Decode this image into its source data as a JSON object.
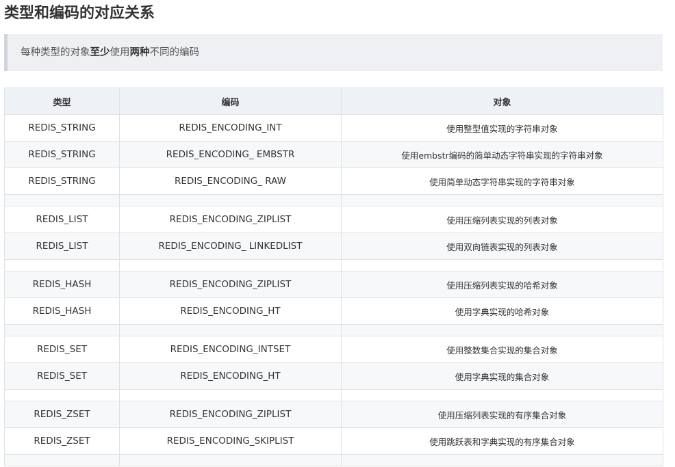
{
  "title": "类型和编码的对应关系",
  "note": {
    "part1": "每种类型的对象",
    "bold1": "至少",
    "part2": "使用",
    "bold2": "两种",
    "part3": "不同的编码"
  },
  "table": {
    "headers": [
      "类型",
      "编码",
      "对象"
    ],
    "rows": [
      {
        "type": "REDIS_STRING",
        "encoding": "REDIS_ENCODING_INT",
        "object": "使用整型值实现的字符串对象"
      },
      {
        "type": "REDIS_STRING",
        "encoding": "REDIS_ENCODING_ EMBSTR",
        "object": "使用embstr编码的简单动态字符串实现的字符串对象"
      },
      {
        "type": "REDIS_STRING",
        "encoding": "REDIS_ENCODING_ RAW",
        "object": "使用简单动态字符串实现的字符串对象"
      },
      {
        "type": "",
        "encoding": "",
        "object": ""
      },
      {
        "type": "REDIS_LIST",
        "encoding": "REDIS_ENCODING_ZIPLIST",
        "object": "使用压缩列表实现的列表对象"
      },
      {
        "type": "REDIS_LIST",
        "encoding": "REDIS_ENCODING_ LINKEDLIST",
        "object": "使用双向链表实现的列表对象"
      },
      {
        "type": "",
        "encoding": "",
        "object": ""
      },
      {
        "type": "REDIS_HASH",
        "encoding": "REDIS_ENCODING_ZIPLIST",
        "object": "使用压缩列表实现的哈希对象"
      },
      {
        "type": "REDIS_HASH",
        "encoding": "REDIS_ENCODING_HT",
        "object": "使用字典实现的哈希对象"
      },
      {
        "type": "",
        "encoding": "",
        "object": ""
      },
      {
        "type": "REDIS_SET",
        "encoding": "REDIS_ENCODING_INTSET",
        "object": "使用整数集合实现的集合对象"
      },
      {
        "type": "REDIS_SET",
        "encoding": "REDIS_ENCODING_HT",
        "object": "使用字典实现的集合对象"
      },
      {
        "type": "",
        "encoding": "",
        "object": ""
      },
      {
        "type": "REDIS_ZSET",
        "encoding": "REDIS_ENCODING_ZIPLIST",
        "object": "使用压缩列表实现的有序集合对象"
      },
      {
        "type": "REDIS_ZSET",
        "encoding": "REDIS_ENCODING_SKIPLIST",
        "object": "使用跳跃表和字典实现的有序集合对象"
      },
      {
        "type": "",
        "encoding": "",
        "object": ""
      }
    ]
  }
}
